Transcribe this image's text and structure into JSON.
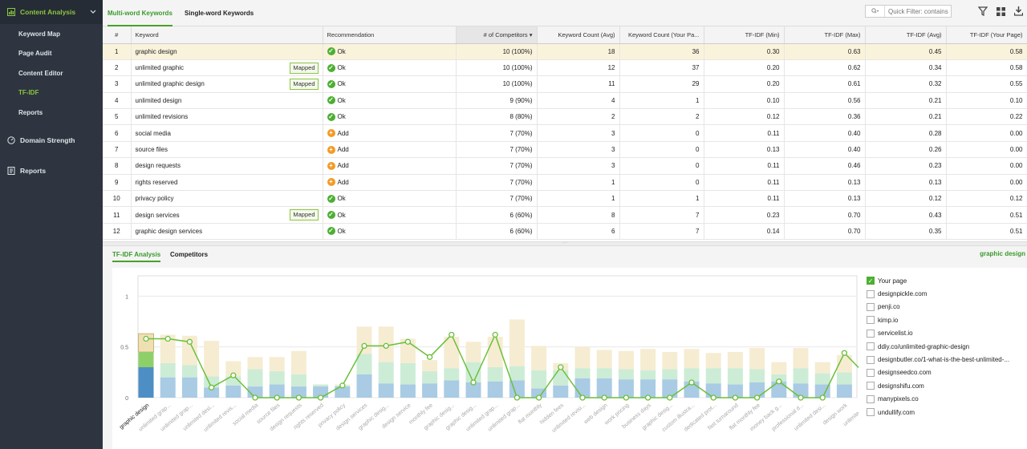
{
  "sidebar": {
    "content_analysis": "Content Analysis",
    "items": [
      {
        "label": "Keyword Map"
      },
      {
        "label": "Page Audit"
      },
      {
        "label": "Content Editor"
      },
      {
        "label": "TF-IDF",
        "active": true
      },
      {
        "label": "Reports"
      }
    ],
    "domain_strength": "Domain Strength",
    "reports": "Reports"
  },
  "tabs": {
    "multi": "Multi-word Keywords",
    "single": "Single-word Keywords"
  },
  "filter": {
    "placeholder": "Quick Filter: contains",
    "value": ""
  },
  "table": {
    "columns": [
      "#",
      "Keyword",
      "Recommendation",
      "# of Competitors",
      "Keyword Count (Avg)",
      "Keyword Count (Your Pa...",
      "TF-IDF (Min)",
      "TF-IDF (Max)",
      "TF-IDF (Avg)",
      "TF-IDF (Your Page)"
    ],
    "rows": [
      {
        "n": "1",
        "kw": "graphic design",
        "mapped": "",
        "rec": "Ok",
        "recType": "ok",
        "comp": "10 (100%)",
        "avg": "18",
        "your": "36",
        "min": "0.30",
        "max": "0.63",
        "tavg": "0.45",
        "typ": "0.58"
      },
      {
        "n": "2",
        "kw": "unlimited graphic",
        "mapped": "Mapped",
        "rec": "Ok",
        "recType": "ok",
        "comp": "10 (100%)",
        "avg": "12",
        "your": "37",
        "min": "0.20",
        "max": "0.62",
        "tavg": "0.34",
        "typ": "0.58"
      },
      {
        "n": "3",
        "kw": "unlimited graphic design",
        "mapped": "Mapped",
        "rec": "Ok",
        "recType": "ok",
        "comp": "10 (100%)",
        "avg": "11",
        "your": "29",
        "min": "0.20",
        "max": "0.61",
        "tavg": "0.32",
        "typ": "0.55"
      },
      {
        "n": "4",
        "kw": "unlimited design",
        "mapped": "",
        "rec": "Ok",
        "recType": "ok",
        "comp": "9 (90%)",
        "avg": "4",
        "your": "1",
        "min": "0.10",
        "max": "0.56",
        "tavg": "0.21",
        "typ": "0.10"
      },
      {
        "n": "5",
        "kw": "unlimited revisions",
        "mapped": "",
        "rec": "Ok",
        "recType": "ok",
        "comp": "8 (80%)",
        "avg": "2",
        "your": "2",
        "min": "0.12",
        "max": "0.36",
        "tavg": "0.21",
        "typ": "0.22"
      },
      {
        "n": "6",
        "kw": "social media",
        "mapped": "",
        "rec": "Add",
        "recType": "add",
        "comp": "7 (70%)",
        "avg": "3",
        "your": "0",
        "min": "0.11",
        "max": "0.40",
        "tavg": "0.28",
        "typ": "0.00"
      },
      {
        "n": "7",
        "kw": "source files",
        "mapped": "",
        "rec": "Add",
        "recType": "add",
        "comp": "7 (70%)",
        "avg": "3",
        "your": "0",
        "min": "0.13",
        "max": "0.40",
        "tavg": "0.26",
        "typ": "0.00"
      },
      {
        "n": "8",
        "kw": "design requests",
        "mapped": "",
        "rec": "Add",
        "recType": "add",
        "comp": "7 (70%)",
        "avg": "3",
        "your": "0",
        "min": "0.11",
        "max": "0.46",
        "tavg": "0.23",
        "typ": "0.00"
      },
      {
        "n": "9",
        "kw": "rights reserved",
        "mapped": "",
        "rec": "Add",
        "recType": "add",
        "comp": "7 (70%)",
        "avg": "1",
        "your": "0",
        "min": "0.11",
        "max": "0.13",
        "tavg": "0.13",
        "typ": "0.00"
      },
      {
        "n": "10",
        "kw": "privacy policy",
        "mapped": "",
        "rec": "Ok",
        "recType": "ok",
        "comp": "7 (70%)",
        "avg": "1",
        "your": "1",
        "min": "0.11",
        "max": "0.13",
        "tavg": "0.12",
        "typ": "0.12"
      },
      {
        "n": "11",
        "kw": "design services",
        "mapped": "Mapped",
        "rec": "Ok",
        "recType": "ok",
        "comp": "6 (60%)",
        "avg": "8",
        "your": "7",
        "min": "0.23",
        "max": "0.70",
        "tavg": "0.43",
        "typ": "0.51"
      },
      {
        "n": "12",
        "kw": "graphic design services",
        "mapped": "",
        "rec": "Ok",
        "recType": "ok",
        "comp": "6 (60%)",
        "avg": "6",
        "your": "7",
        "min": "0.14",
        "max": "0.70",
        "tavg": "0.35",
        "typ": "0.51"
      }
    ]
  },
  "bottom": {
    "tab_tfidf": "TF-IDF Analysis",
    "tab_competitors": "Competitors",
    "keyword": "graphic design"
  },
  "legend": [
    {
      "label": "Your page",
      "checked": true
    },
    {
      "label": "designpickle.com",
      "checked": false
    },
    {
      "label": "penji.co",
      "checked": false
    },
    {
      "label": "kimp.io",
      "checked": false
    },
    {
      "label": "servicelist.io",
      "checked": false
    },
    {
      "label": "ddiy.co/unlimited-graphic-design",
      "checked": false
    },
    {
      "label": "designbutler.co/1-what-is-the-best-unlimited-...",
      "checked": false
    },
    {
      "label": "designseedco.com",
      "checked": false
    },
    {
      "label": "designshifu.com",
      "checked": false
    },
    {
      "label": "manypixels.co",
      "checked": false
    },
    {
      "label": "undullify.com",
      "checked": false
    }
  ],
  "colors": {
    "accent": "#4aa02c",
    "min": "#a9cbe4",
    "avg": "#cdecd6",
    "max": "#f6ecd2",
    "line": "#6bbf3a"
  },
  "chart_data": {
    "type": "bar",
    "yticks": [
      "0",
      "0.5",
      "1"
    ],
    "ylim": [
      0,
      1.2
    ],
    "categories": [
      "graphic design",
      "unlimited grap...",
      "unlimited grap...",
      "unlimited desi...",
      "unlimited revis...",
      "social media",
      "source files",
      "design requests",
      "rights reserved",
      "privacy policy",
      "design services",
      "graphic desig...",
      "design service",
      "monthly fee",
      "graphic desig...",
      "graphic desig...",
      "unlimited grap...",
      "unlimited grap...",
      "flat monthly",
      "hidden fees",
      "unlimited revisi...",
      "web design",
      "work pricing",
      "business days",
      "graphic desig...",
      "custom illustra...",
      "dedicated prot...",
      "fast turnaround",
      "flat monthly fee",
      "money back g...",
      "professional d...",
      "unlimited desi...",
      "design work",
      "unlimited fr..."
    ],
    "series": [
      {
        "name": "TF-IDF (Min)",
        "values": [
          0.3,
          0.2,
          0.2,
          0.1,
          0.12,
          0.11,
          0.13,
          0.11,
          0.11,
          0.11,
          0.23,
          0.14,
          0.13,
          0.14,
          0.17,
          0.15,
          0.16,
          0.17,
          0.09,
          0.12,
          0.19,
          0.19,
          0.18,
          0.18,
          0.18,
          0.16,
          0.14,
          0.13,
          0.15,
          0.16,
          0.14,
          0.13,
          0.13,
          0.18
        ]
      },
      {
        "name": "TF-IDF (Avg)",
        "values": [
          0.45,
          0.34,
          0.32,
          0.21,
          0.21,
          0.28,
          0.26,
          0.23,
          0.13,
          0.12,
          0.43,
          0.35,
          0.34,
          0.26,
          0.29,
          0.35,
          0.3,
          0.31,
          0.27,
          0.27,
          0.29,
          0.29,
          0.28,
          0.27,
          0.28,
          0.29,
          0.29,
          0.29,
          0.28,
          0.23,
          0.29,
          0.24,
          0.25,
          0.22
        ]
      },
      {
        "name": "TF-IDF (Max)",
        "values": [
          0.63,
          0.62,
          0.61,
          0.56,
          0.36,
          0.4,
          0.4,
          0.46,
          0.13,
          0.13,
          0.7,
          0.7,
          0.58,
          0.37,
          0.6,
          0.55,
          0.6,
          0.77,
          0.51,
          0.34,
          0.5,
          0.47,
          0.46,
          0.48,
          0.45,
          0.48,
          0.44,
          0.45,
          0.49,
          0.35,
          0.49,
          0.35,
          0.42,
          0.26
        ]
      },
      {
        "name": "Your page",
        "values": [
          0.58,
          0.58,
          0.55,
          0.1,
          0.22,
          0.0,
          0.0,
          0.0,
          0.0,
          0.12,
          0.51,
          0.51,
          0.55,
          0.4,
          0.62,
          0.15,
          0.62,
          0.0,
          0.0,
          0.3,
          0.0,
          0.0,
          0.0,
          0.0,
          0.0,
          0.15,
          0.0,
          0.0,
          0.0,
          0.16,
          0.0,
          0.0,
          0.44,
          0.22
        ]
      }
    ]
  }
}
